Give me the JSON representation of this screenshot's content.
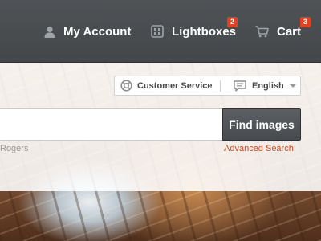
{
  "header": {
    "nav": [
      {
        "label": "My Account",
        "icon": "user-icon"
      },
      {
        "label": "Lightboxes",
        "icon": "lightbox-icon",
        "badge": "2"
      },
      {
        "label": "Cart",
        "icon": "cart-icon",
        "badge": "3"
      }
    ]
  },
  "utility": {
    "customer_service": {
      "label": "Customer Service",
      "icon": "lifebuoy-icon"
    },
    "language": {
      "selected": "English",
      "icon": "speech-bubble-icon"
    }
  },
  "search": {
    "value": "",
    "button_label": "Find images",
    "advanced_link": "Advanced Search",
    "photo_credit": "Rogers"
  },
  "colors": {
    "header_bg": "#474b4e",
    "badge": "#e2401e",
    "link_accent": "#d24a1e",
    "button_bg": "#525659"
  }
}
